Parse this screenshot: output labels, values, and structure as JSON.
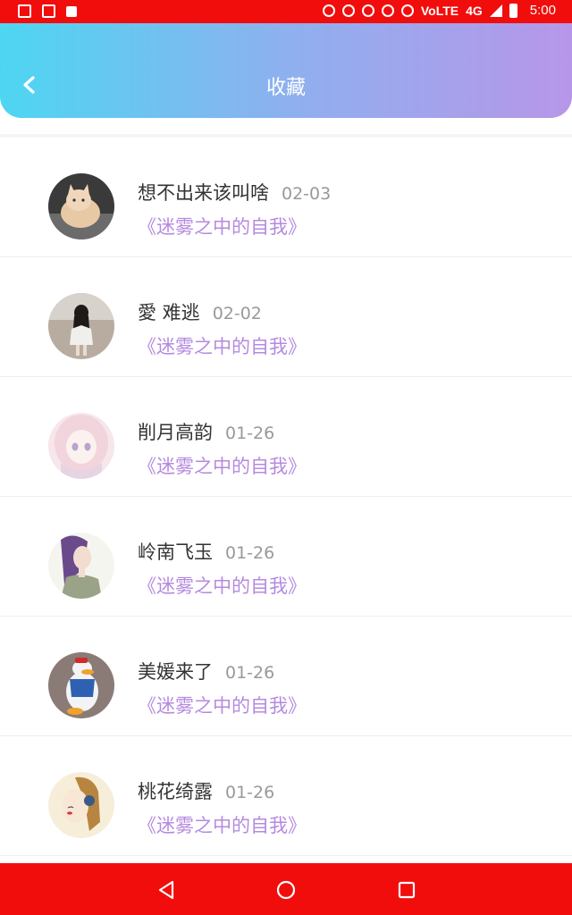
{
  "status_bar": {
    "network": "4G",
    "volte": "VoLTE",
    "time": "5:00"
  },
  "header": {
    "title": "收藏"
  },
  "favorites": [
    {
      "name": "想不出来该叫啥",
      "date": "02-03",
      "book": "《迷雾之中的自我》",
      "avatar": "cat-avatar"
    },
    {
      "name": "愛 难逃",
      "date": "02-02",
      "book": "《迷雾之中的自我》",
      "avatar": "girl-photo-avatar"
    },
    {
      "name": "削月高韵",
      "date": "01-26",
      "book": "《迷雾之中的自我》",
      "avatar": "anime-girl-avatar"
    },
    {
      "name": "岭南飞玉",
      "date": "01-26",
      "book": "《迷雾之中的自我》",
      "avatar": "illustrated-girl-avatar"
    },
    {
      "name": "美媛来了",
      "date": "01-26",
      "book": "《迷雾之中的自我》",
      "avatar": "donald-duck-avatar"
    },
    {
      "name": "桃花绮露",
      "date": "01-26",
      "book": "《迷雾之中的自我》",
      "avatar": "sketch-girl-avatar"
    }
  ],
  "colors": {
    "status_bar": "#f20d0d",
    "header_gradient_start": "#4dd6f2",
    "header_gradient_end": "#b796e9",
    "book_title": "#b58ae0"
  }
}
